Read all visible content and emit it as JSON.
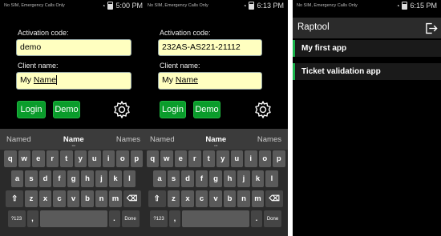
{
  "phone1": {
    "status": {
      "left": "No SIM, Emergency Calls Only",
      "time": "5:00 PM"
    },
    "activation_label": "Activation code:",
    "activation_value": "demo",
    "client_label": "Client name:",
    "client_value_prefix": "My ",
    "client_value_underlined": "Name",
    "login_label": "Login",
    "demo_label": "Demo"
  },
  "phone2": {
    "status": {
      "left": "No SIM, Emergency Calls Only",
      "time": "6:13 PM"
    },
    "activation_label": "Activation code:",
    "activation_value": "232AS-AS221-21112",
    "client_label": "Client name:",
    "client_value_prefix": "My ",
    "client_value_underlined": "Name",
    "login_label": "Login",
    "demo_label": "Demo"
  },
  "keyboard": {
    "suggestions": [
      "Named",
      "Name",
      "Names"
    ],
    "row1": [
      "q",
      "w",
      "e",
      "r",
      "t",
      "y",
      "u",
      "i",
      "o",
      "p"
    ],
    "row2": [
      "a",
      "s",
      "d",
      "f",
      "g",
      "h",
      "j",
      "k",
      "l"
    ],
    "row3": [
      "z",
      "x",
      "c",
      "v",
      "b",
      "n",
      "m"
    ],
    "sym_label": "?123",
    "comma": ",",
    "period": ".",
    "done_label": "Done"
  },
  "phone3": {
    "status": {
      "left": "No SIM, Emergency Calls Only",
      "time": "6:15 PM"
    },
    "app_title": "Raptool",
    "items": [
      "My first app",
      "Ticket validation app"
    ]
  },
  "colors": {
    "accent": "#0a9c2b",
    "input_bg": "#ffffc0",
    "list_accent": "#18b24a"
  }
}
